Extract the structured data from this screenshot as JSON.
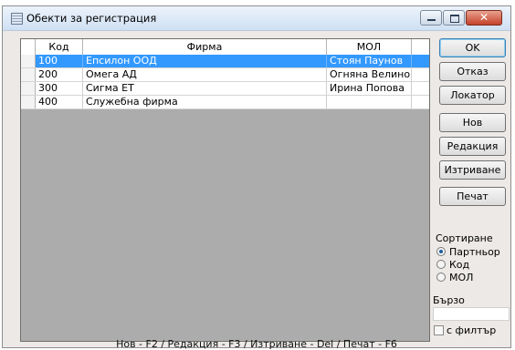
{
  "window": {
    "title": "Обекти за регистрация",
    "controls": {
      "minimize": "–",
      "maximize": "□",
      "close": "✕"
    }
  },
  "grid": {
    "columns": [
      "Код",
      "Фирма",
      "МОЛ"
    ],
    "rows": [
      {
        "code": "100",
        "firm": "Епсилон ООД",
        "mol": "Стоян Паунов",
        "selected": true
      },
      {
        "code": "200",
        "firm": "Омега АД",
        "mol": "Огняна Велинова",
        "selected": false
      },
      {
        "code": "300",
        "firm": "Сигма ЕТ",
        "mol": "Ирина Попова",
        "selected": false
      },
      {
        "code": "400",
        "firm": "Служебна фирма",
        "mol": "",
        "selected": false
      }
    ]
  },
  "buttons": {
    "ok": "OK",
    "cancel": "Отказ",
    "locator": "Локатор",
    "new": "Нов",
    "edit": "Редакция",
    "delete": "Изтриване",
    "print": "Печат"
  },
  "sort": {
    "label": "Сортиране",
    "options": [
      "Партньор",
      "Код",
      "МОЛ"
    ],
    "selected": "Партньор"
  },
  "quick_search": {
    "label": "Бързо търсене",
    "value": ""
  },
  "filter": {
    "label": "с филтър",
    "checked": false
  },
  "status": {
    "shortcuts": "Нов - F2 / Редакция - F3 / Изтриване - Del / Печат - F6"
  }
}
